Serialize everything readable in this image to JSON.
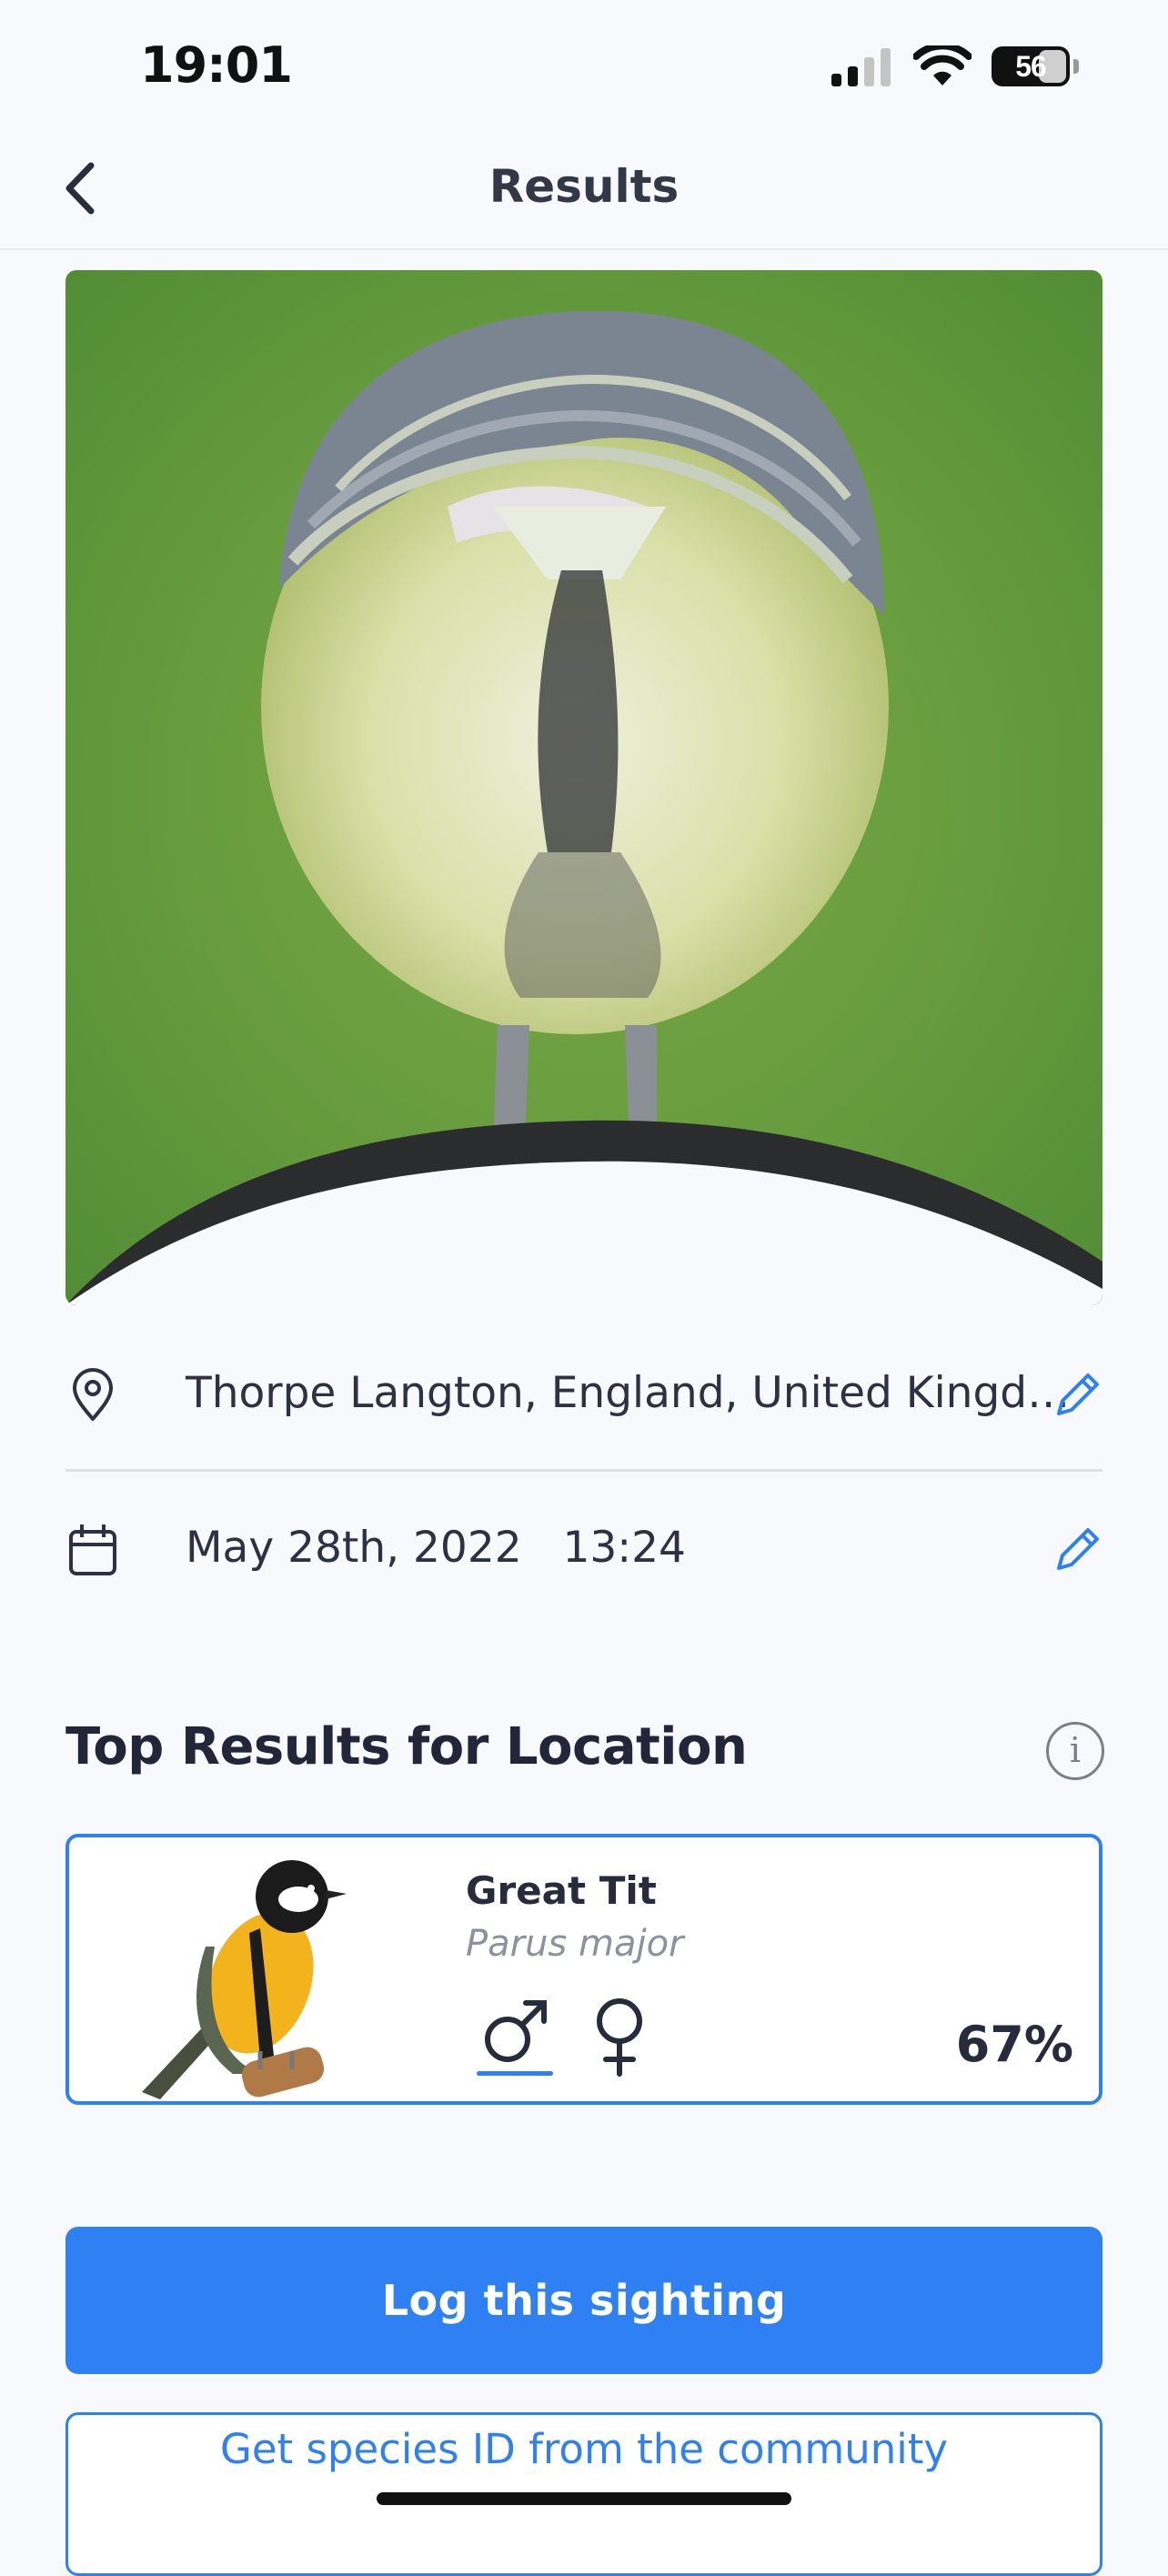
{
  "status_bar": {
    "time": "19:01",
    "battery": "56"
  },
  "header": {
    "title": "Results"
  },
  "location": {
    "text": "Thorpe Langton, England, United Kingd…"
  },
  "datetime": {
    "date": "May 28th, 2022",
    "time": "13:24"
  },
  "section": {
    "title": "Top Results for Location"
  },
  "result": {
    "common_name": "Great Tit",
    "scientific_name": "Parus major",
    "confidence": "67%",
    "selected_sex": "male"
  },
  "actions": {
    "log_label": "Log this sighting",
    "community_label": "Get species ID from the community"
  },
  "colors": {
    "accent": "#2f80f2",
    "background": "#f8f9fc"
  }
}
